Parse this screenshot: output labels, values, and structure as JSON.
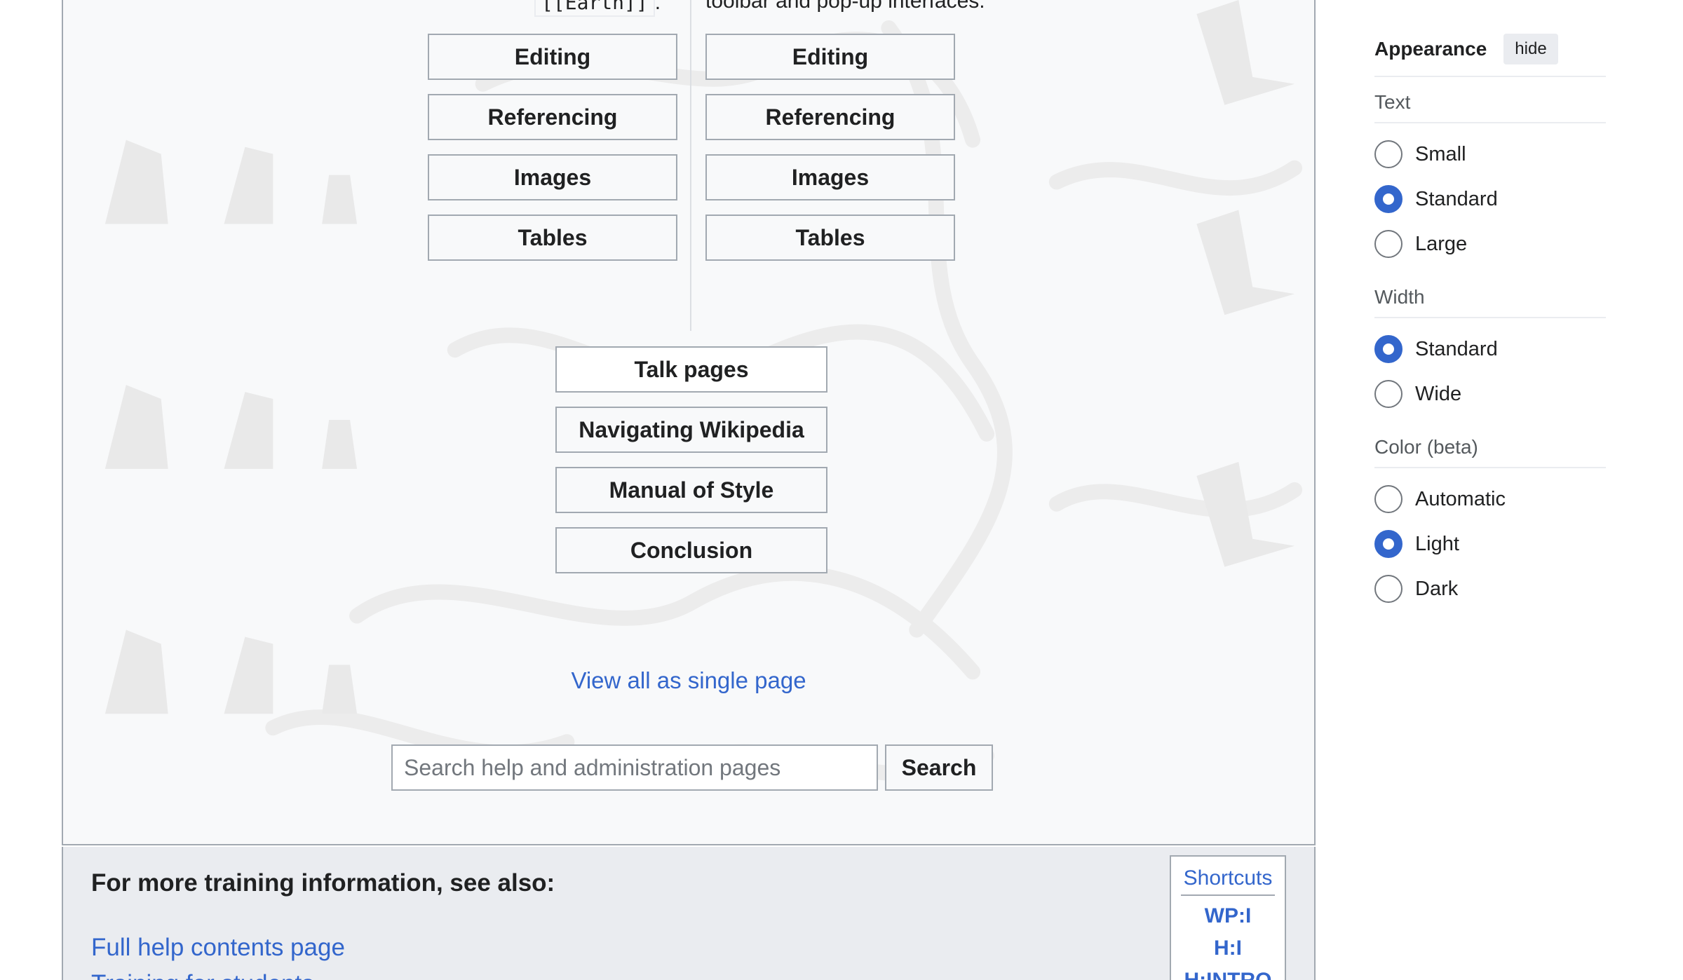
{
  "content": {
    "partial_left": "[[Earth]]",
    "partial_left_suffix": ".",
    "partial_right": "toolbar and pop-up interfaces.",
    "column_a_buttons": [
      "Editing",
      "Referencing",
      "Images",
      "Tables"
    ],
    "column_b_buttons": [
      "Editing",
      "Referencing",
      "Images",
      "Tables"
    ],
    "shared_buttons": [
      "Talk pages",
      "Navigating Wikipedia",
      "Manual of Style",
      "Conclusion"
    ],
    "single_page_link": "View all as single page",
    "search": {
      "placeholder": "Search help and administration pages",
      "value": "",
      "button_label": "Search"
    }
  },
  "see_also": {
    "heading": "For more training information, see also:",
    "links": [
      "Full help contents page",
      "Training for students"
    ],
    "shortcuts": {
      "title": "Shortcuts",
      "items": [
        "WP:I",
        "H:I",
        "H:INTRO"
      ]
    }
  },
  "appearance": {
    "title": "Appearance",
    "hide_label": "hide",
    "sections": [
      {
        "label": "Text",
        "options": [
          "Small",
          "Standard",
          "Large"
        ],
        "selected": "Standard"
      },
      {
        "label": "Width",
        "options": [
          "Standard",
          "Wide"
        ],
        "selected": "Standard"
      },
      {
        "label": "Color (beta)",
        "options": [
          "Automatic",
          "Light",
          "Dark"
        ],
        "selected": "Light"
      }
    ]
  },
  "colors": {
    "link": "#3366cc",
    "border": "#a2a9b1",
    "panel_bg": "#f8f9fa",
    "see_also_bg": "#eaecf0",
    "radio_checked": "#3366cc"
  }
}
